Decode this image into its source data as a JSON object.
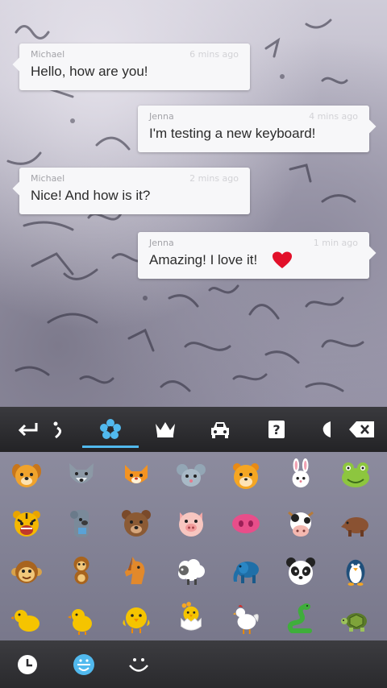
{
  "messages": [
    {
      "sender": "Michael",
      "time": "6 mins ago",
      "text": "Hello, how are you!",
      "side": "left"
    },
    {
      "sender": "Jenna",
      "time": "4 mins ago",
      "text": "I'm testing a new keyboard!",
      "side": "right"
    },
    {
      "sender": "Michael",
      "time": "2 mins ago",
      "text": "Nice! And how is it?",
      "side": "left"
    },
    {
      "sender": "Jenna",
      "time": "1 min ago",
      "text": "Amazing! I love it!",
      "side": "right",
      "emoji": "heart-icon"
    }
  ],
  "keyboard": {
    "toolbar": [
      {
        "icon": "enter-icon"
      },
      {
        "icon": "emoticon-wink-icon"
      },
      {
        "icon": "flower-icon",
        "selected": true
      },
      {
        "icon": "crown-icon"
      },
      {
        "icon": "car-icon"
      },
      {
        "icon": "question-box-icon",
        "label": "?"
      },
      {
        "icon": "bubble-icon"
      },
      {
        "icon": "backspace-icon"
      }
    ],
    "accent_color": "#51b9ee",
    "emoji_rows": [
      [
        "dog-face",
        "wolf-face",
        "cat-face",
        "mouse-face",
        "hamster-face",
        "rabbit-face",
        "frog-face"
      ],
      [
        "tiger-face",
        "koala",
        "bear-face",
        "pig-face",
        "pig-nose",
        "cow-face",
        "boar"
      ],
      [
        "monkey-face",
        "monkey",
        "horse-head",
        "sheep",
        "elephant",
        "panda-face",
        "penguin"
      ],
      [
        "chick",
        "baby-chick",
        "front-chick",
        "hatching-chick",
        "rooster",
        "snake",
        "turtle"
      ]
    ],
    "bottom_bar": [
      {
        "icon": "recent-clock-icon"
      },
      {
        "icon": "smiley-face-icon",
        "selected": true
      },
      {
        "icon": "emoticon-text-icon"
      }
    ]
  }
}
